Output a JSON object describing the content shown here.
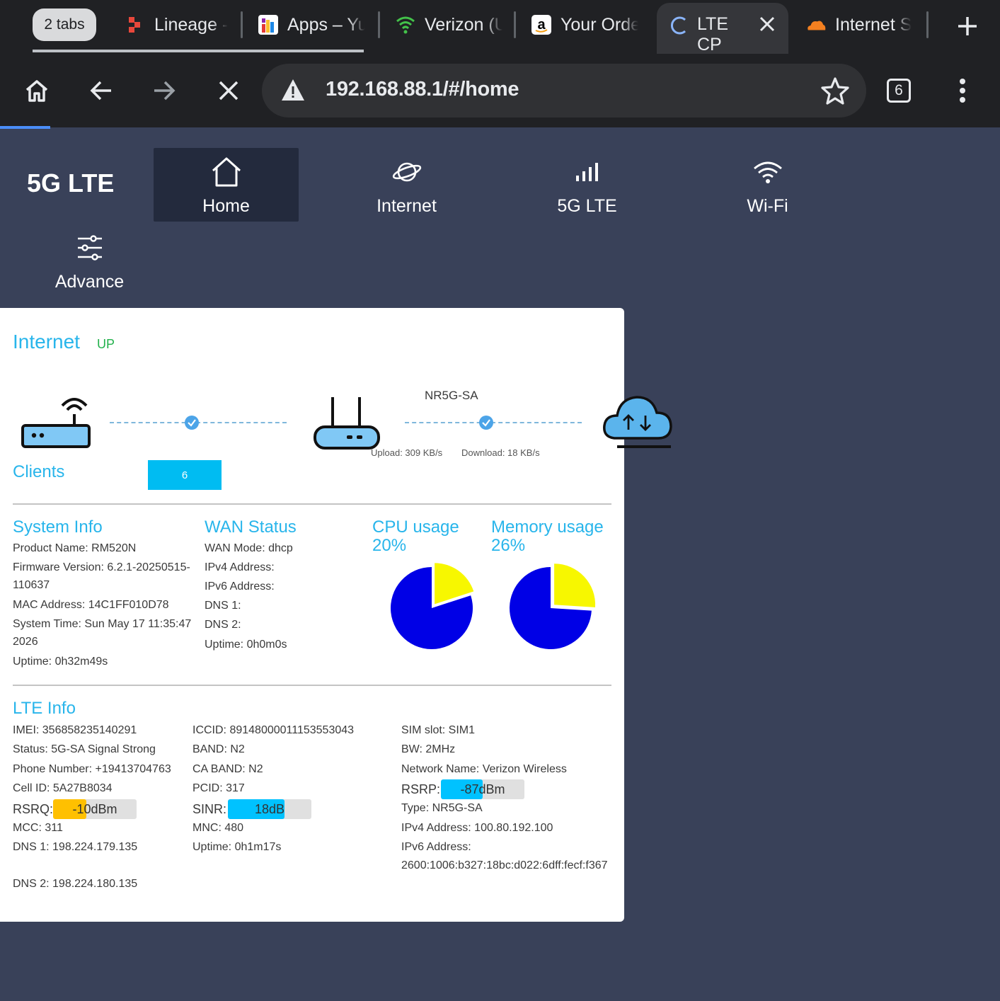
{
  "browser": {
    "tabs_count_label": "2 tabs",
    "tabs": [
      {
        "label": "Lineage -"
      },
      {
        "label": "Apps – Yu"
      },
      {
        "label": "Verizon (U"
      },
      {
        "label": "Your Orde"
      },
      {
        "label": "LTE CP",
        "active": true
      },
      {
        "label": "Internet S"
      }
    ],
    "url": "192.168.88.1/#/home",
    "tab_switcher_count": "6"
  },
  "router": {
    "brand": "5G LTE",
    "nav": [
      {
        "label": "Home",
        "icon": "home-icon",
        "active": true
      },
      {
        "label": "Internet",
        "icon": "planet-icon"
      },
      {
        "label": "5G LTE",
        "icon": "signal-bars-icon"
      },
      {
        "label": "Wi-Fi",
        "icon": "wifi-icon"
      },
      {
        "label": "Advance",
        "icon": "sliders-icon"
      }
    ]
  },
  "internet": {
    "title": "Internet",
    "status": "UP",
    "connection_type": "NR5G-SA",
    "upload": "Upload: 309 KB/s",
    "download": "Download: 18 KB/s",
    "clients_label": "Clients",
    "clients_count": "6"
  },
  "system_info": {
    "title": "System Info",
    "lines": [
      "Product Name: RM520N",
      "Firmware Version: 6.2.1-20250515-",
      "110637",
      "MAC Address: 14C1FF010D78",
      "System Time: Sun May 17 11:35:47",
      "2026",
      "Uptime: 0h32m49s"
    ]
  },
  "wan_status": {
    "title": "WAN Status",
    "lines": [
      "WAN Mode: dhcp",
      "IPv4 Address:",
      "IPv6 Address:",
      "DNS 1:",
      "DNS 2:",
      "Uptime: 0h0m0s"
    ]
  },
  "cpu": {
    "title": "CPU usage",
    "value_label": "20%",
    "percent": 20
  },
  "memory": {
    "title": "Memory usage",
    "value_label": "26%",
    "percent": 26
  },
  "colors": {
    "pie_used": "#f7f700",
    "pie_free": "#0000e6",
    "accent": "#28b5eb",
    "status_up": "#22b14c",
    "meter_blue": "#00c2ff",
    "meter_yellow": "#ffc000"
  },
  "lte_info": {
    "title": "LTE Info",
    "col1": {
      "imei": "IMEI: 356858235140291",
      "status": "Status: 5G-SA Signal Strong",
      "phone": "Phone Number: +19413704763",
      "cell_id": "Cell ID: 5A27B8034",
      "rsrq_label": "RSRQ:",
      "rsrq_value": "-10dBm",
      "mcc": "MCC: 311",
      "dns1": "DNS 1: 198.224.179.135",
      "dns2": "DNS 2: 198.224.180.135"
    },
    "col2": {
      "iccid": "ICCID: 89148000011153553043",
      "band": "BAND: N2",
      "ca_band": "CA BAND: N2",
      "pcid": "PCID: 317",
      "sinr_label": "SINR:",
      "sinr_value": "18dB",
      "mnc": "MNC: 480",
      "uptime": "Uptime: 0h1m17s"
    },
    "col3": {
      "sim_slot": "SIM slot: SIM1",
      "bw": "BW: 2MHz",
      "network": "Network Name: Verizon Wireless",
      "rsrp_label": "RSRP:",
      "rsrp_value": "-87dBm",
      "type": "Type: NR5G-SA",
      "ipv4": "IPv4 Address: 100.80.192.100",
      "ipv6_label": "IPv6 Address:",
      "ipv6_value": "2600:1006:b327:18bc:d022:6dff:fecf:f367"
    },
    "meters": {
      "rsrq_fill": 0.4,
      "sinr_fill": 0.68,
      "rsrp_fill": 0.5
    }
  }
}
